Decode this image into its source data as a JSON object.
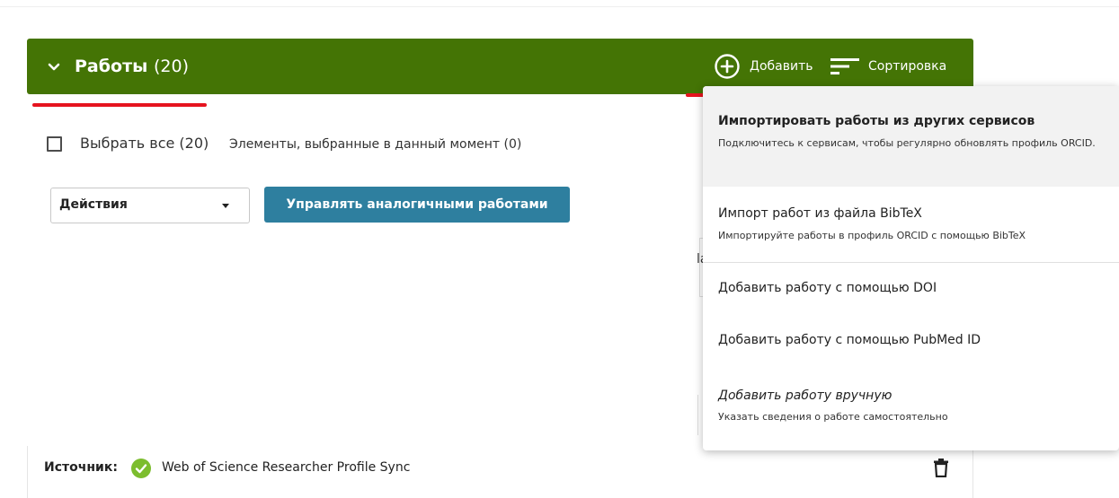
{
  "works": {
    "title": "Работы",
    "count": "(20)",
    "add_label": "Добавить",
    "sort_label": "Сортировка"
  },
  "selection": {
    "select_all_label": "Выбрать все (20)",
    "selected_now": "Элементы, выбранные в данный момент (0)"
  },
  "actions": {
    "select_value": "Действия",
    "manage_button": "Управлять аналогичными работами"
  },
  "hidden_fragment": "la",
  "source": {
    "label": "Источник:",
    "name": "Web of Science Researcher Profile Sync"
  },
  "add_menu": {
    "items": [
      {
        "title": "Импортировать работы из других сервисов",
        "subtitle": "Подключитесь к сервисам, чтобы регулярно обновлять профиль ORCID."
      },
      {
        "title": "Импорт работ из файла BibTeX",
        "subtitle": "Импортируйте работы в профиль ORCID с помощью BibTeX"
      },
      {
        "title": "Добавить работу с помощью DOI"
      },
      {
        "title": "Добавить работу с помощью PubMed ID"
      },
      {
        "title": "Добавить работу вручную",
        "subtitle": "Указать сведения о работе самостоятельно"
      }
    ]
  },
  "colors": {
    "header_bg": "#447405",
    "button_bg": "#2e7f9f",
    "annotation_red": "#e6141f",
    "check_green": "#7cbd2e"
  },
  "icons": [
    "chevron-down-icon",
    "add-circle-icon",
    "sort-icon",
    "checkbox-icon",
    "caret-down-icon",
    "check-circle-icon",
    "trash-icon"
  ]
}
